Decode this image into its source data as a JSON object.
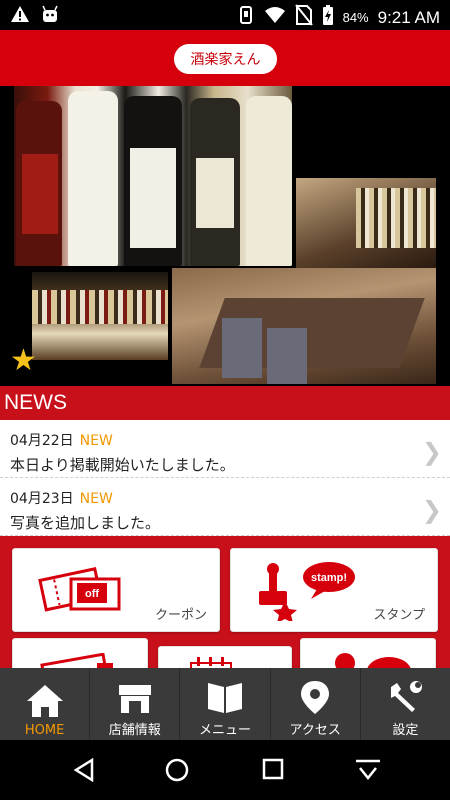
{
  "status_bar": {
    "battery": "84%",
    "time": "9:21 AM"
  },
  "header": {
    "store_name": "酒楽家えん"
  },
  "news": {
    "title": "NEWS",
    "items": [
      {
        "date": "04月22日",
        "badge": "NEW",
        "text": "本日より掲載開始いたしました。"
      },
      {
        "date": "04月23日",
        "badge": "NEW",
        "text": "写真を追加しました。"
      }
    ]
  },
  "menu_tiles": {
    "coupon_label": "クーポン",
    "stamp_label": "スタンプ",
    "off_text": "off",
    "stamp_text": "stamp!"
  },
  "tab_bar": {
    "tabs": [
      {
        "label": "HOME",
        "icon": "home-icon"
      },
      {
        "label": "店舗情報",
        "icon": "shop-icon"
      },
      {
        "label": "メニュー",
        "icon": "book-icon"
      },
      {
        "label": "アクセス",
        "icon": "location-pin-icon"
      },
      {
        "label": "設定",
        "icon": "wrench-icon"
      }
    ]
  },
  "colors": {
    "accent_red": "#d6000d",
    "new_badge": "#f39800",
    "active_tab": "#f39800"
  }
}
